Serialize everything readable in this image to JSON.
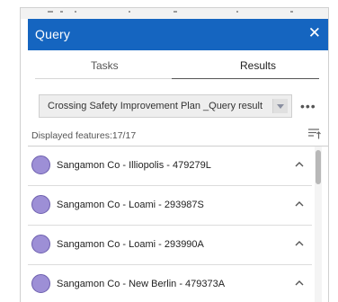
{
  "window": {
    "title": "Query",
    "close_icon": "close-icon"
  },
  "tabs": [
    {
      "label": "Tasks",
      "active": false
    },
    {
      "label": "Results",
      "active": true
    }
  ],
  "result_select": {
    "value": "Crossing Safety Improvement Plan _Query result"
  },
  "status": {
    "displayed": "Displayed features:17/17"
  },
  "results": [
    {
      "label": "Sangamon Co - Illiopolis - 479279L"
    },
    {
      "label": "Sangamon Co - Loami - 293987S"
    },
    {
      "label": "Sangamon Co - Loami - 293990A"
    },
    {
      "label": "Sangamon Co - New Berlin - 479373A"
    }
  ],
  "colors": {
    "title_bar": "#1565c0",
    "feature_symbol": "#9d8fd6",
    "feature_symbol_outline": "#6d5fae"
  }
}
